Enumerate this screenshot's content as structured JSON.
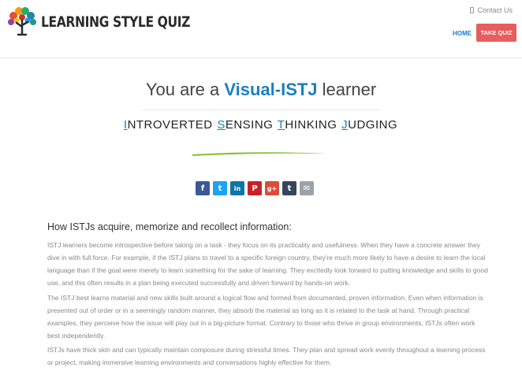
{
  "header": {
    "logo_text": "LEARNING STYLE QUIZ",
    "contact_label": "Contact Us",
    "nav_home": "HOME",
    "take_quiz": "TAKE QUIZ"
  },
  "result": {
    "prefix": "You are a ",
    "type": "Visual-ISTJ",
    "suffix": " learner",
    "mbti_words": [
      {
        "cap": "I",
        "rest": "NTROVERTED"
      },
      {
        "cap": "S",
        "rest": "ENSING"
      },
      {
        "cap": "T",
        "rest": "HINKING"
      },
      {
        "cap": "J",
        "rest": "UDGING"
      }
    ]
  },
  "share": [
    {
      "name": "facebook",
      "glyph": "f",
      "color": "#3b5998"
    },
    {
      "name": "twitter",
      "glyph": "t",
      "color": "#1da1f2"
    },
    {
      "name": "linkedin",
      "glyph": "in",
      "color": "#0e76a8"
    },
    {
      "name": "pinterest",
      "glyph": "P",
      "color": "#cb2027"
    },
    {
      "name": "google-plus",
      "glyph": "g+",
      "color": "#dd4b39"
    },
    {
      "name": "tumblr",
      "glyph": "t",
      "color": "#35465c"
    },
    {
      "name": "email",
      "glyph": "✉",
      "color": "#9aa3a8"
    }
  ],
  "content": {
    "heading": "How ISTJs acquire, memorize and recollect information:",
    "paragraphs": [
      "ISTJ learners become introspective before taking on a task - they focus on its practicality and usefulness. When they have a concrete answer they dive in with full force. For example, if the ISTJ plans to travel to a specific foreign country, they're much more likely to have a desire to learn the local language than if the goal were merely to learn something for the sake of learning. They excitedly look forward to putting knowledge and skills to good use, and this often results in a plan being executed successfully and driven forward by hands-on work.",
      "The ISTJ best learns material and new skills built around a logical flow and formed from documented, proven information. Even when information is presented out of order or in a seemingly random manner, they absorb the material as long as it is related to the task at hand. Through practical examples, they perceive how the issue will play out in a big-picture format. Contrary to those who thrive in group environments, ISTJs often work best independently.",
      "ISTJs have thick skin and can typically maintain composure during stressful times. They plan and spread work evenly throughout a learning process or project, making immersive learning environments and conversations highly effective for them."
    ]
  },
  "colors": {
    "accent_blue": "#1a7fbf",
    "take_quiz_bg": "#e85d5d",
    "accent_green": "#8bbf3a"
  }
}
